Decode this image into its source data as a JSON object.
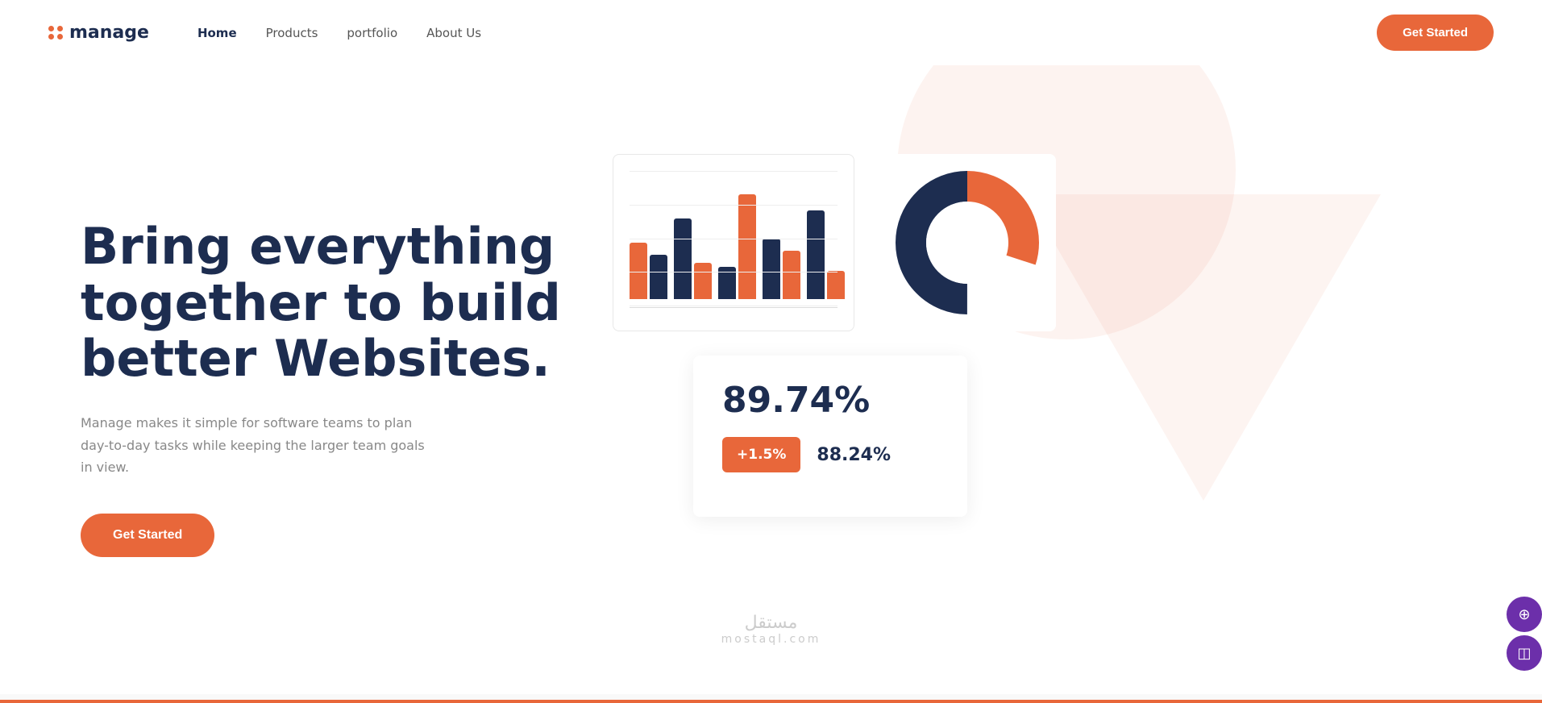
{
  "brand": {
    "name": "manage"
  },
  "nav": {
    "links": [
      {
        "label": "Home",
        "active": true
      },
      {
        "label": "Products",
        "active": false
      },
      {
        "label": "portfolio",
        "active": false
      },
      {
        "label": "About Us",
        "active": false
      }
    ],
    "cta": "Get Started"
  },
  "hero": {
    "headline": "Bring everything together to build better Websites.",
    "subtext": "Manage makes it simple for software teams to plan day-to-day tasks while keeping the larger team goals in view.",
    "cta": "Get Started"
  },
  "chart_bar": {
    "bars": [
      {
        "navy": 60,
        "orange": 90
      },
      {
        "navy": 110,
        "orange": 50
      },
      {
        "navy": 40,
        "orange": 130
      },
      {
        "navy": 80,
        "orange": 70
      },
      {
        "navy": 120,
        "orange": 40
      }
    ]
  },
  "chart_donut": {
    "orange_pct": 30,
    "navy_pct": 70
  },
  "stats": {
    "big_value": "89.74%",
    "badge_value": "+1.5%",
    "secondary_value": "88.24%"
  },
  "watermark": {
    "arabic": "مستقل",
    "latin": "mostaql.com"
  }
}
